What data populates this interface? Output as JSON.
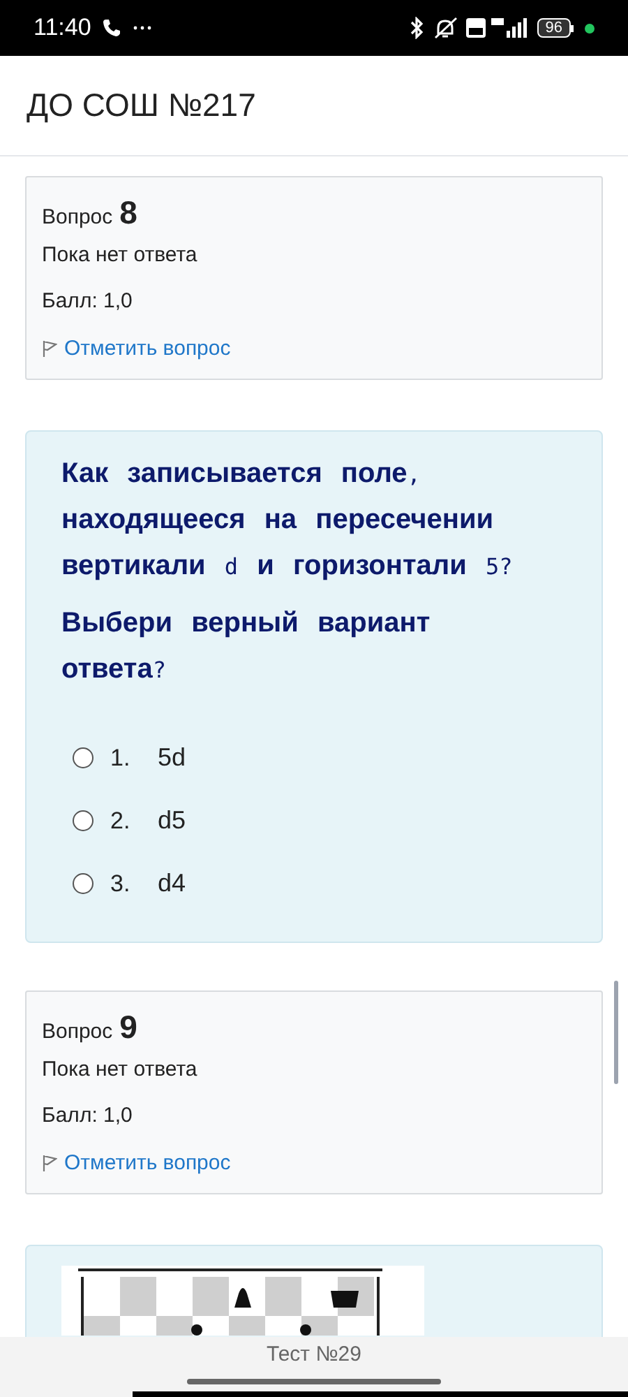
{
  "status_bar": {
    "time": "11:40",
    "battery": "96"
  },
  "header": {
    "title": "ДО СОШ №217"
  },
  "cards": [
    {
      "kind": "info",
      "label": "Вопрос",
      "number": "8",
      "state": "Пока нет ответа",
      "score": "Балл: 1,0",
      "flag_link": "Отметить вопрос"
    },
    {
      "kind": "question",
      "paragraphs": [
        [
          {
            "text": "Как записывается поле",
            "mono": false
          },
          {
            "text": ",",
            "mono": true
          },
          {
            "text": " находящееся на пересечении вертикали ",
            "mono": false
          },
          {
            "text": "d",
            "mono": true
          },
          {
            "text": " и горизонтали ",
            "mono": false
          },
          {
            "text": "5?",
            "mono": true
          }
        ],
        [
          {
            "text": "Выбери верный вариант ответа",
            "mono": false
          },
          {
            "text": "?",
            "mono": true
          }
        ]
      ],
      "options": [
        {
          "number": "1.",
          "text": "5d",
          "selected": false
        },
        {
          "number": "2.",
          "text": "d5",
          "selected": false
        },
        {
          "number": "3.",
          "text": "d4",
          "selected": false
        }
      ]
    },
    {
      "kind": "info",
      "label": "Вопрос",
      "number": "9",
      "state": "Пока нет ответа",
      "score": "Балл: 1,0",
      "flag_link": "Отметить вопрос"
    },
    {
      "kind": "picture"
    }
  ],
  "footer": {
    "title": "Тест №29"
  }
}
